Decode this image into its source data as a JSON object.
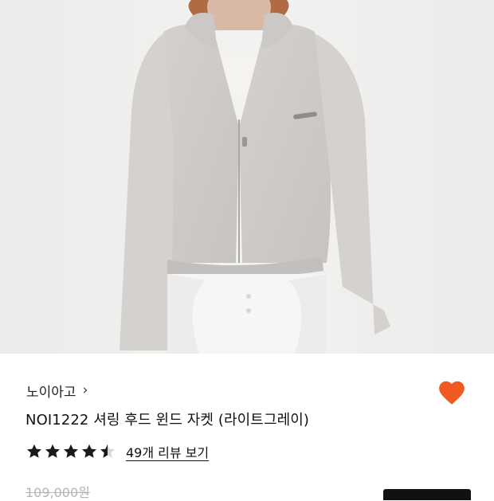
{
  "product": {
    "brand": "노이아고",
    "brand_chevron": "›",
    "title": "NOI1222 셔링 후드 윈드 자켓 (라이트그레이)",
    "rating": 4.5,
    "review_link": "49개 리뷰 보기",
    "original_price": "109,000원",
    "wishlisted": true
  },
  "colors": {
    "heart": "#f05a22",
    "star": "#1a1a1a",
    "strike_price": "#b5b5b5"
  },
  "icons": {
    "wishlist": "heart-icon",
    "chevron": "chevron-right-icon",
    "rating": "star-icon"
  }
}
